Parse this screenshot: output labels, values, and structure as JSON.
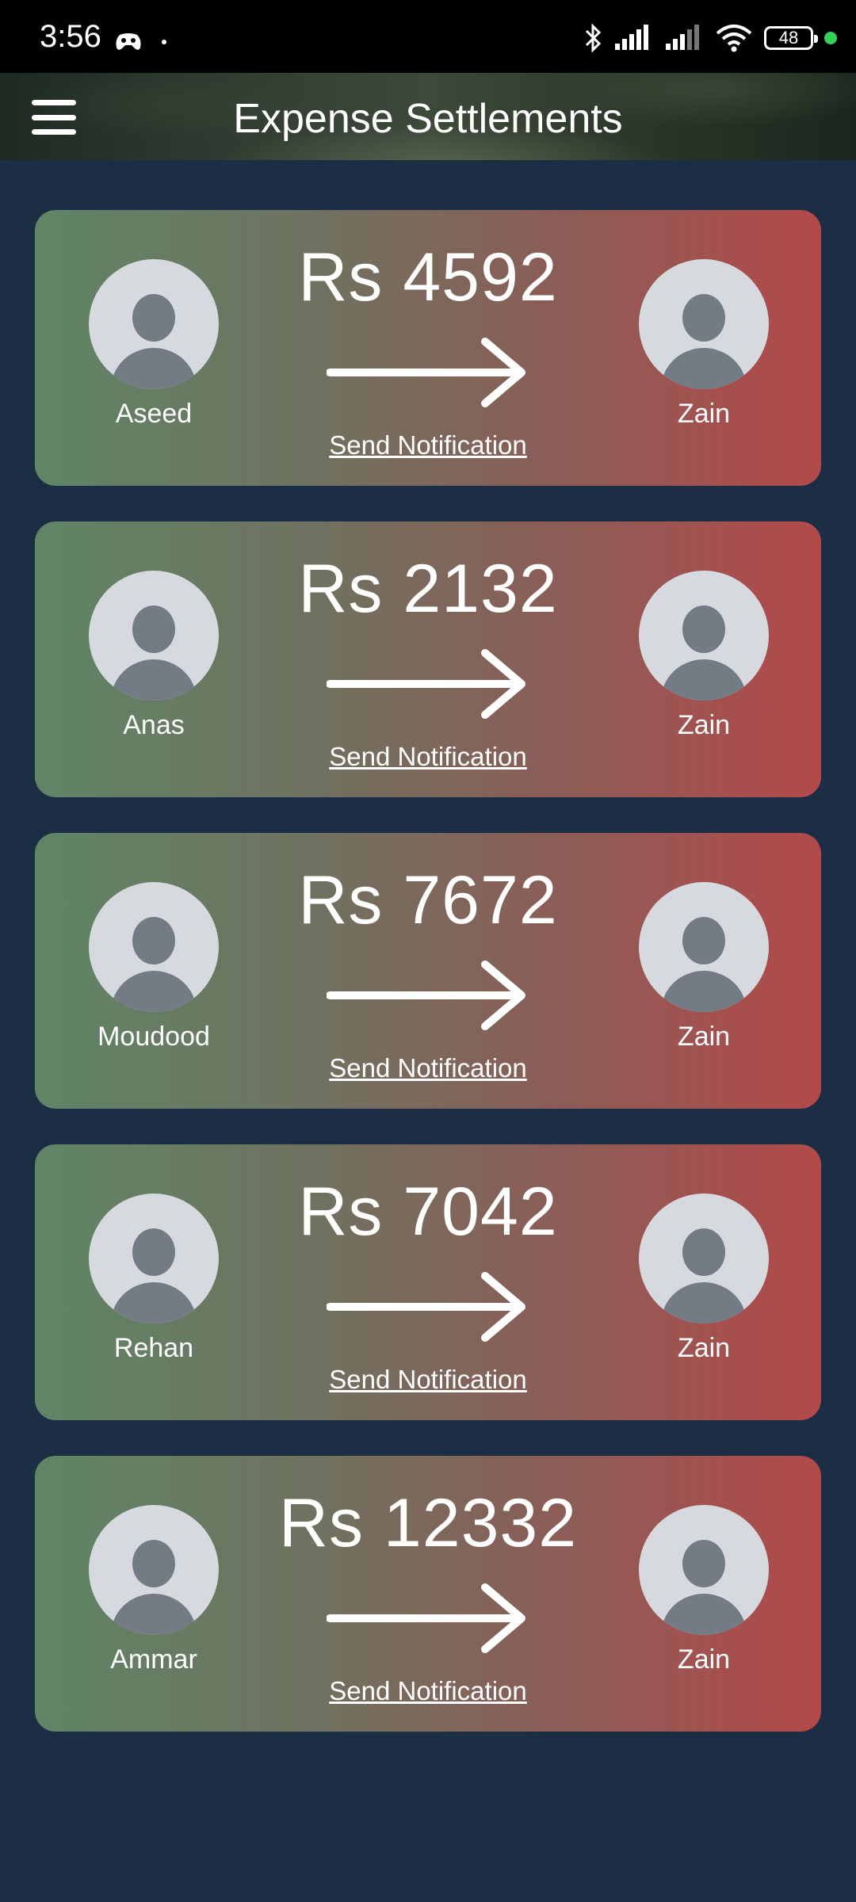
{
  "status_bar": {
    "time": "3:56",
    "battery": "48"
  },
  "app_bar": {
    "title": "Expense Settlements"
  },
  "settlements": [
    {
      "from": "Aseed",
      "to": "Zain",
      "amount": "Rs 4592",
      "action": "Send Notification"
    },
    {
      "from": "Anas",
      "to": "Zain",
      "amount": "Rs 2132",
      "action": "Send Notification"
    },
    {
      "from": "Moudood",
      "to": "Zain",
      "amount": "Rs 7672",
      "action": "Send Notification"
    },
    {
      "from": "Rehan",
      "to": "Zain",
      "amount": "Rs 7042",
      "action": "Send Notification"
    },
    {
      "from": "Ammar",
      "to": "Zain",
      "amount": "Rs 12332",
      "action": "Send Notification"
    }
  ],
  "colors": {
    "background": "#1c2e44",
    "card_gradient_start": "#5f8566",
    "card_gradient_end": "#b3494a",
    "avatar_bg": "#d6d9de",
    "avatar_figure": "#737b85"
  },
  "icons": {
    "menu": "hamburger-icon",
    "avatar": "default-user-icon",
    "arrow": "right-arrow-icon"
  }
}
